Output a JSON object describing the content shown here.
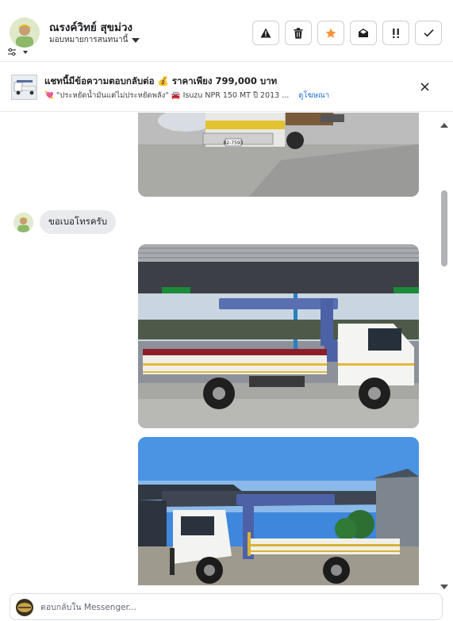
{
  "header": {
    "contact_name": "ณรงค์วิทย์ สุขม่วง",
    "assign_label": "มอบหมายการสนทนานี้",
    "actions": [
      {
        "name": "report-button",
        "icon": "warning-icon"
      },
      {
        "name": "delete-button",
        "icon": "trash-icon"
      },
      {
        "name": "star-button",
        "icon": "star-icon",
        "color": "#f7923b"
      },
      {
        "name": "mark-unread-button",
        "icon": "envelope-open-icon"
      },
      {
        "name": "spam-button",
        "icon": "exclamation-icon"
      },
      {
        "name": "done-button",
        "icon": "check-icon"
      }
    ]
  },
  "ad": {
    "title": "แชทนี้มีข้อความตอบกลับต่อ 💰 ราคาเพียง 799,000 บาท",
    "subtitle": "💘 \"ประหยัดน้ำมันแต่ไม่ประหยัดพลัง\" 🚘 Isuzu NPR 150 MT ปี 2013 ...",
    "link": "ดูโฆษณา"
  },
  "messages": [
    {
      "type": "image",
      "sender": "page",
      "desc": "truck-photo-front"
    },
    {
      "type": "text",
      "sender": "customer",
      "text": "ขอเบอโทรครับ"
    },
    {
      "type": "image",
      "sender": "page",
      "desc": "crane-truck-side"
    },
    {
      "type": "image",
      "sender": "page",
      "desc": "crane-truck-front"
    }
  ],
  "composer": {
    "placeholder": "ตอบกลับใน Messenger..."
  },
  "colors": {
    "accent": "#1a6ed8",
    "star": "#f7923b",
    "bubble": "#e9eaed"
  }
}
